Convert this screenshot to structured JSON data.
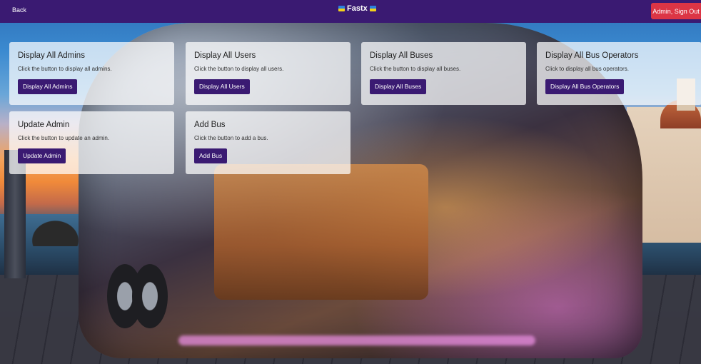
{
  "navbar": {
    "back_label": "Back",
    "brand": "Fastx",
    "signout_label": "Admin, Sign Out"
  },
  "cards": [
    {
      "title": "Display All Admins",
      "text": "Click the button to display all admins.",
      "button": "Display All Admins"
    },
    {
      "title": "Display All Users",
      "text": "Click the button to display all users.",
      "button": "Display All Users"
    },
    {
      "title": "Display All Buses",
      "text": "Click the button to display all buses.",
      "button": "Display All Buses"
    },
    {
      "title": "Display All Bus Operators",
      "text": "Click to display all bus operators.",
      "button": "Display All Bus Operators"
    },
    {
      "title": "Update Admin",
      "text": "Click the button to update an admin.",
      "button": "Update Admin"
    },
    {
      "title": "Add Bus",
      "text": "Click the button to add a bus.",
      "button": "Add Bus"
    }
  ],
  "colors": {
    "navbar": "#3a1a72",
    "button": "#3a1a72",
    "signout": "#dc3545"
  },
  "icons": {
    "brand_left": "flag-icon",
    "brand_right": "flag-icon"
  }
}
